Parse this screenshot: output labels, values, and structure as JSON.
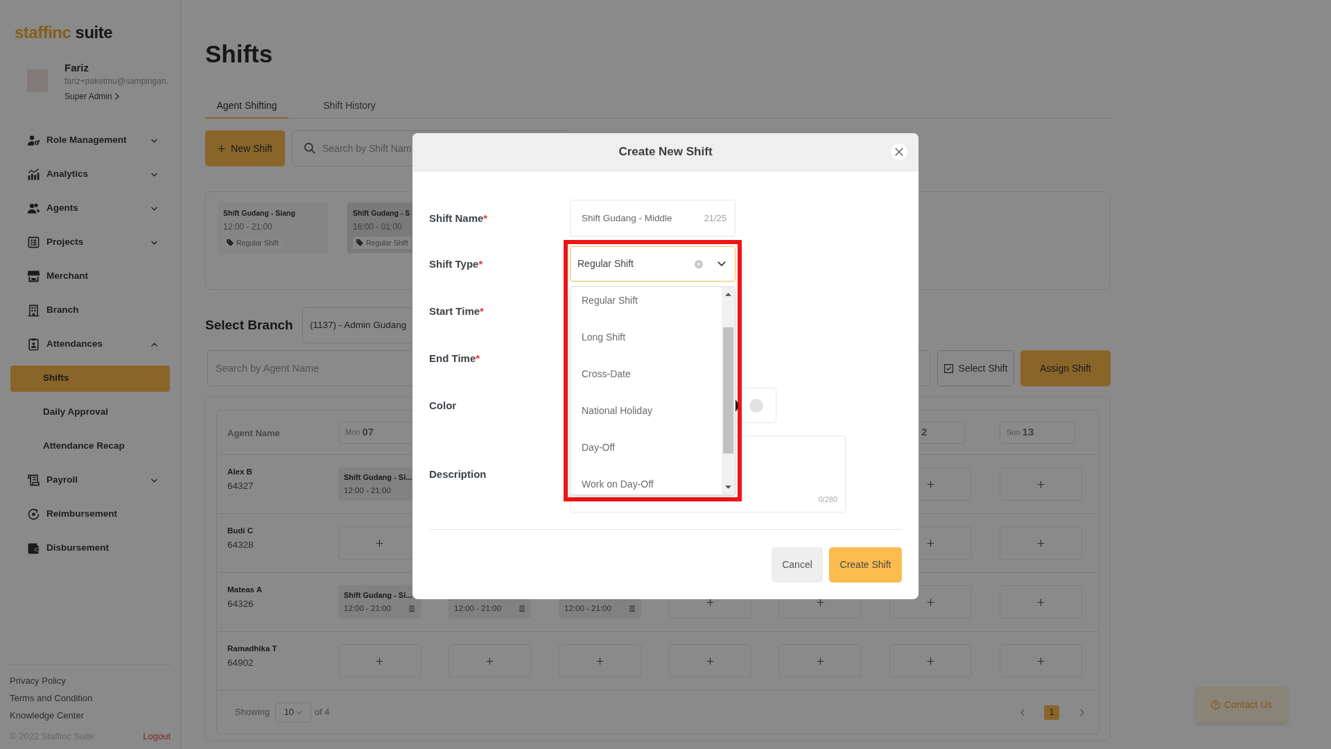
{
  "sidebar": {
    "logo": {
      "brand": "staffinc",
      "suffix": "suite"
    },
    "user": {
      "name": "Fariz",
      "email": "fariz+paketmu@sampingan.",
      "role": "Super Admin"
    },
    "menu": [
      {
        "label": "Role Management",
        "expanded": false
      },
      {
        "label": "Analytics",
        "expanded": false
      },
      {
        "label": "Agents",
        "expanded": false
      },
      {
        "label": "Projects",
        "expanded": false
      },
      {
        "label": "Merchant"
      },
      {
        "label": "Branch"
      },
      {
        "label": "Attendances",
        "expanded": true,
        "children": [
          {
            "label": "Shifts",
            "selected": true
          },
          {
            "label": "Daily Approval",
            "selected": false
          },
          {
            "label": "Attendance Recap",
            "selected": false
          }
        ]
      },
      {
        "label": "Payroll",
        "expanded": false
      },
      {
        "label": "Reimbursement"
      },
      {
        "label": "Disbursement"
      }
    ],
    "footer_links": [
      "Privacy Policy",
      "Terms and Condition",
      "Knowledge Center"
    ],
    "copyright": "© 2022 Staffinc Suite",
    "logout": "Logout"
  },
  "page": {
    "title": "Shifts",
    "tabs": [
      {
        "label": "Agent Shifting",
        "selected": true
      },
      {
        "label": "Shift History",
        "selected": false
      }
    ],
    "new_shift_button": "New Shift",
    "shift_search": {
      "placeholder": "Search by Shift Nam"
    },
    "shift_cards": [
      {
        "name": "Shift Gudang - Siang",
        "time": "12:00 - 21:00",
        "type": "Regular Shift",
        "color": "#858585"
      },
      {
        "name": "Shift Gudang - S",
        "time": "16:00 - 01:00",
        "type": "Regular Shift",
        "color": "#7a7a7a"
      }
    ],
    "branch": {
      "label": "Select Branch",
      "value": "(1137) - Admin Gudang"
    },
    "agent_search": {
      "placeholder": "Search by Agent Name"
    },
    "actions": [
      {
        "label": "Select Shift",
        "kind": "outline"
      },
      {
        "label": "Assign Shift",
        "kind": "primary"
      }
    ],
    "table": {
      "agent_column": "Agent Name",
      "days": [
        {
          "day": "Mon",
          "date": "07"
        },
        {
          "date": "2"
        },
        {
          "day": "Sun",
          "date": "13"
        }
      ],
      "rows": [
        {
          "name": "Alex B",
          "id": "64327",
          "cells": [
            {
              "kind": "shift",
              "name": "Shift Gudang - Si...",
              "time": "12:00 - 21:00",
              "building_icon": false
            },
            {
              "kind": "add"
            },
            {
              "kind": "add"
            }
          ]
        },
        {
          "name": "Budi C",
          "id": "64328",
          "cells": [
            {
              "kind": "add"
            },
            {
              "kind": "add"
            },
            {
              "kind": "add"
            }
          ]
        },
        {
          "name": "Mateas A",
          "id": "64326",
          "cells": [
            {
              "kind": "shift",
              "name": "Shift Gudang - Si...",
              "time": "12:00 - 21:00",
              "building_icon": true
            },
            {
              "kind": "shift",
              "time": "12:00 - 21:00",
              "building_icon": true
            },
            {
              "kind": "shift",
              "time": "12:00 - 21:00",
              "building_icon": true
            },
            {
              "kind": "add"
            },
            {
              "kind": "add"
            },
            {
              "kind": "add"
            },
            {
              "kind": "add"
            }
          ]
        },
        {
          "name": "Ramadhika T",
          "id": "64902",
          "cells": [
            {
              "kind": "add"
            },
            {
              "kind": "add"
            },
            {
              "kind": "add"
            },
            {
              "kind": "add"
            },
            {
              "kind": "add"
            },
            {
              "kind": "add"
            },
            {
              "kind": "add"
            }
          ]
        }
      ]
    },
    "pagination": {
      "showing_label": "Showing",
      "page_size": "10",
      "total": "of 4",
      "pages": [
        {
          "label": "1",
          "selected": true
        }
      ]
    },
    "contact_button": "Contact Us"
  },
  "modal": {
    "title": "Create New Shift",
    "shift_name": {
      "label": "Shift Name",
      "required_mark": "*",
      "value": "Shift Gudang - Middle",
      "counter": "21/25"
    },
    "shift_type": {
      "label": "Shift Type",
      "required_mark": "*",
      "value": "Regular Shift",
      "highlighted": true,
      "options": [
        "Regular Shift",
        "Long Shift",
        "Cross-Date",
        "National Holiday",
        "Day-Off",
        "Work on Day-Off"
      ]
    },
    "start_time": {
      "label": "Start Time",
      "required_mark": "*"
    },
    "end_time": {
      "label": "End Time",
      "required_mark": "*"
    },
    "color": {
      "label": "Color",
      "swatches": [
        {
          "color": "#1c1c1c"
        },
        {
          "color": "#e2e2e2"
        }
      ]
    },
    "description": {
      "label": "Description",
      "counter": "0/280"
    },
    "buttons": [
      {
        "label": "Cancel",
        "kind": "secondary"
      },
      {
        "label": "Create Shift",
        "kind": "primary"
      }
    ]
  }
}
